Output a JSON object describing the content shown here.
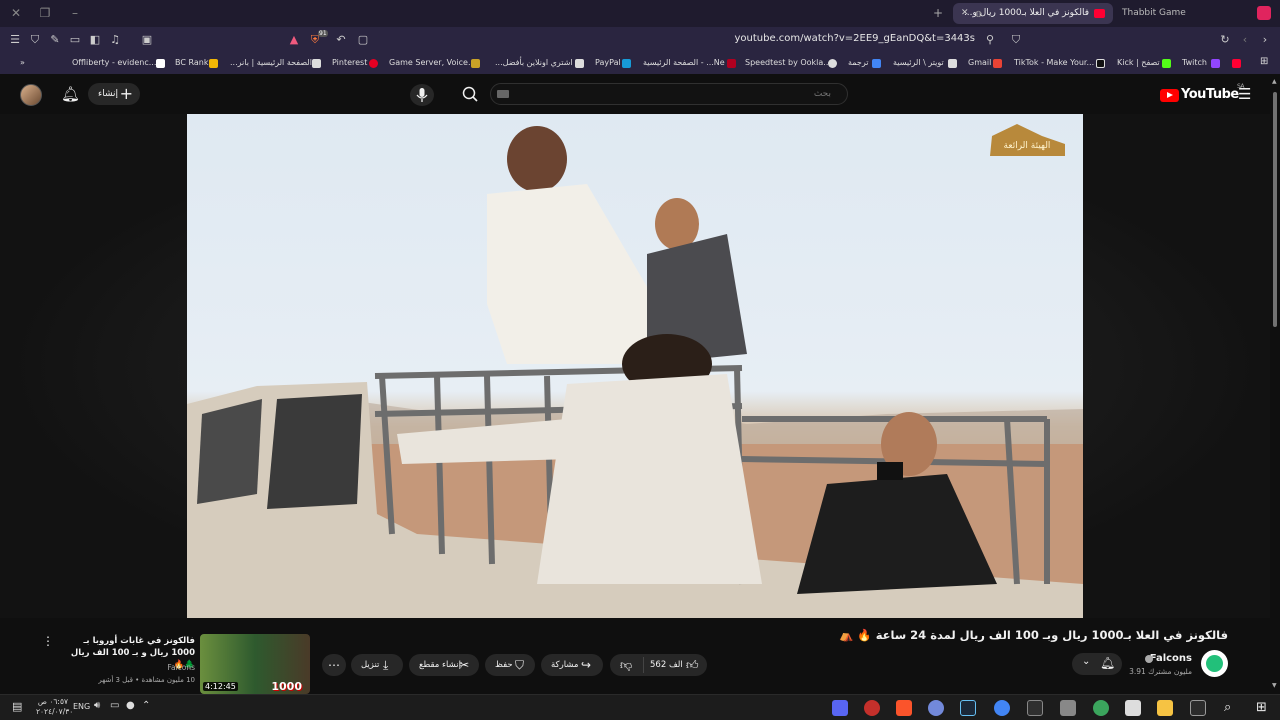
{
  "browser": {
    "active_tab_title": "فالكونز في العلا بـ1000 ريال و...",
    "inactive_tab_title": "Thabbit Game",
    "url": "youtube.com/watch?v=2EE9_gEanDQ&t=3443s",
    "shield_count": "91"
  },
  "bookmarks": [
    {
      "label": "Offliberty - evidenc..."
    },
    {
      "label": "BC Rank"
    },
    {
      "label": "الصفحة الرئيسية | بانر..."
    },
    {
      "label": "Pinterest"
    },
    {
      "label": "Game Server, Voice..."
    },
    {
      "label": "اشتري اونلاين بأفضل..."
    },
    {
      "label": "PayPal"
    },
    {
      "label": "Ne... - الصفحة الرئيسية"
    },
    {
      "label": "Speedtest by Ookla..."
    },
    {
      "label": "ترجمة"
    },
    {
      "label": "تويتر \\ الرئيسية"
    },
    {
      "label": "Gmail"
    },
    {
      "label": "TikTok - Make Your..."
    },
    {
      "label": "Kick | تصفح"
    },
    {
      "label": "Twitch"
    }
  ],
  "youtube": {
    "logo_text": "YouTube",
    "country_code": "SA",
    "search_placeholder": "بحث",
    "create_label": "إنشاء",
    "video": {
      "title": "فالكونز في العلا بـ1000 ريال وبـ 100 الف ريال لمدة 24 ساعة 🔥 ⛺",
      "channel": "Falcons",
      "subscribers": "3.91 مليون مشترك",
      "likes": "562 الف",
      "share_label": "مشاركة",
      "save_label": "حفظ",
      "clip_label": "إنشاء مقطع",
      "download_label": "تنزيل",
      "watermark": "الهيئة الرائعة"
    },
    "recommendation": {
      "title": "فالكونز في غابات أوروبا بـ 1000 ريال و بـ 100 الف ريال 🌲🔥",
      "channel": "Falcons",
      "meta": "10 مليون مشاهدة • قبل 3 أشهر",
      "duration": "4:12:45",
      "thumb_text": "1000"
    }
  },
  "taskbar": {
    "time": "٠٦:٥٧ ص",
    "date": "٢٠٢٤/٠٧/٣٠",
    "lang": "ENG"
  },
  "colors": {
    "accent_red": "#ff0000",
    "browser_frame": "#2a2540",
    "yt_bg": "#0f0f0f"
  }
}
